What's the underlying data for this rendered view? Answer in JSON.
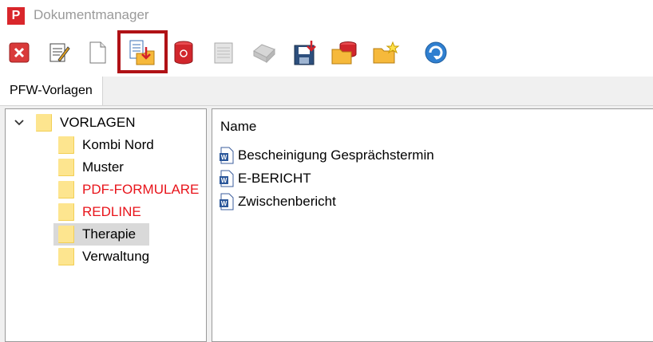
{
  "window": {
    "title": "Dokumentmanager",
    "logo_letter": "P"
  },
  "toolbar": {
    "buttons": [
      {
        "name": "close-icon"
      },
      {
        "name": "edit-document-icon"
      },
      {
        "name": "new-document-icon"
      },
      {
        "name": "import-document-icon"
      },
      {
        "name": "delete-database-icon"
      },
      {
        "name": "notes-icon"
      },
      {
        "name": "print-icon"
      },
      {
        "name": "save-export-icon"
      },
      {
        "name": "open-folder-database-icon"
      },
      {
        "name": "new-folder-icon"
      },
      {
        "name": "refresh-icon"
      }
    ],
    "highlight_color": "#b01216"
  },
  "tabs": [
    {
      "label": "PFW-Vorlagen"
    }
  ],
  "tree": {
    "root": "VORLAGEN",
    "items": [
      {
        "label": "Kombi Nord",
        "color": "#000000"
      },
      {
        "label": "Muster",
        "color": "#000000"
      },
      {
        "label": "PDF-FORMULARE",
        "color": "#e8141b"
      },
      {
        "label": "REDLINE",
        "color": "#e8141b"
      },
      {
        "label": "Therapie",
        "color": "#000000",
        "selected": true
      },
      {
        "label": "Verwaltung",
        "color": "#000000"
      }
    ]
  },
  "list": {
    "column_header": "Name",
    "files": [
      {
        "name": "Bescheinigung Gesprächstermin"
      },
      {
        "name": "E-BERICHT"
      },
      {
        "name": "Zwischenbericht"
      }
    ]
  }
}
